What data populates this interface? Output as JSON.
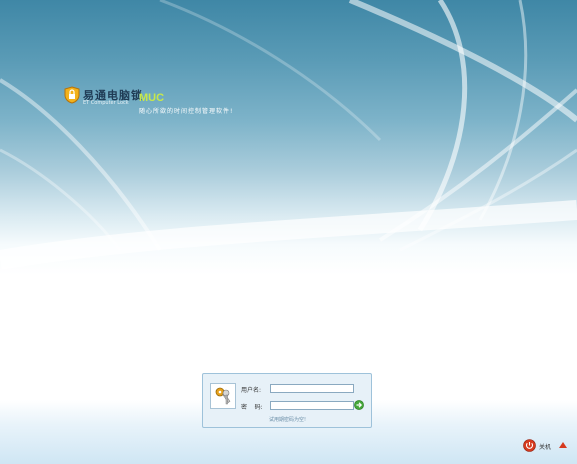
{
  "logo": {
    "title": "易通电脑锁",
    "subtitle": "ET Computer Lock",
    "muc": "MUC",
    "slogan": "随心所欲的时间控制管理软件!"
  },
  "login": {
    "username_label": "用户名:",
    "username_value": "",
    "password_label": "密    码:",
    "password_value": "",
    "hint": "试用期密码为空!"
  },
  "footer": {
    "power_label": "关机",
    "power_icon": "power-icon",
    "up_icon": "arrow-up-icon"
  },
  "colors": {
    "sky_top": "#3f87a6",
    "panel_bg": "#e7f1f8",
    "go_button": "#45a83a",
    "power_icon": "#d63a1e",
    "muc": "#c7e84a"
  }
}
